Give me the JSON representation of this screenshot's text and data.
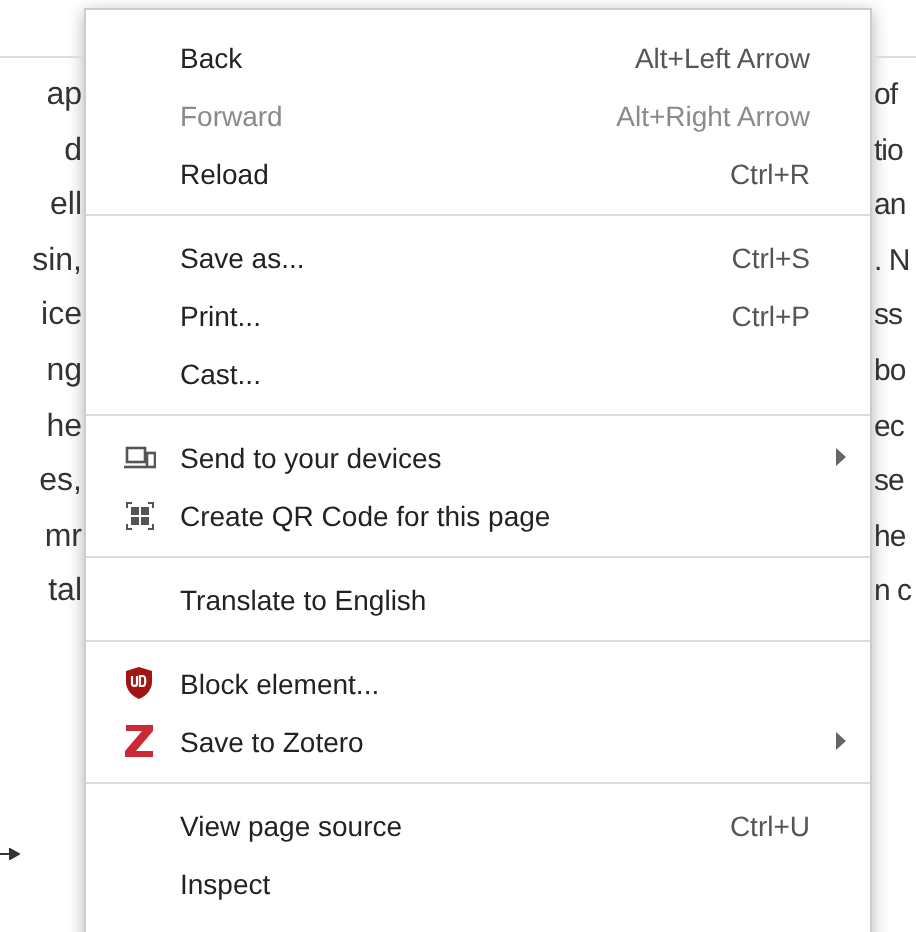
{
  "page": {
    "left_lines": [
      "ap",
      "d",
      "ell",
      "sin,",
      "ice",
      "ng",
      "he",
      "es,",
      "mr",
      "tal"
    ],
    "right_lines": [
      "of",
      "tio",
      "an",
      ". N",
      "ss",
      "bo",
      "ec",
      "se",
      "he",
      "n c"
    ]
  },
  "context_menu": {
    "sections": [
      [
        {
          "kind": "text",
          "label": "Back",
          "shortcut": "Alt+Left Arrow",
          "disabled": false,
          "submenu": false
        },
        {
          "kind": "text",
          "label": "Forward",
          "shortcut": "Alt+Right Arrow",
          "disabled": true,
          "submenu": false
        },
        {
          "kind": "text",
          "label": "Reload",
          "shortcut": "Ctrl+R",
          "disabled": false,
          "submenu": false
        }
      ],
      [
        {
          "kind": "text",
          "label": "Save as...",
          "shortcut": "Ctrl+S",
          "disabled": false,
          "submenu": false
        },
        {
          "kind": "text",
          "label": "Print...",
          "shortcut": "Ctrl+P",
          "disabled": false,
          "submenu": false
        },
        {
          "kind": "text",
          "label": "Cast...",
          "disabled": false,
          "submenu": false
        }
      ],
      [
        {
          "kind": "devices",
          "label": "Send to your devices",
          "disabled": false,
          "submenu": true
        },
        {
          "kind": "qr",
          "label": "Create QR Code for this page",
          "disabled": false,
          "submenu": false
        }
      ],
      [
        {
          "kind": "text",
          "label": "Translate to English",
          "disabled": false,
          "submenu": false
        }
      ],
      [
        {
          "kind": "shield",
          "label": "Block element...",
          "disabled": false,
          "submenu": false
        },
        {
          "kind": "zotero",
          "label": "Save to Zotero",
          "disabled": false,
          "submenu": true
        }
      ],
      [
        {
          "kind": "text",
          "label": "View page source",
          "shortcut": "Ctrl+U",
          "disabled": false,
          "submenu": false
        },
        {
          "kind": "text",
          "label": "Inspect",
          "disabled": false,
          "submenu": false
        }
      ]
    ]
  }
}
